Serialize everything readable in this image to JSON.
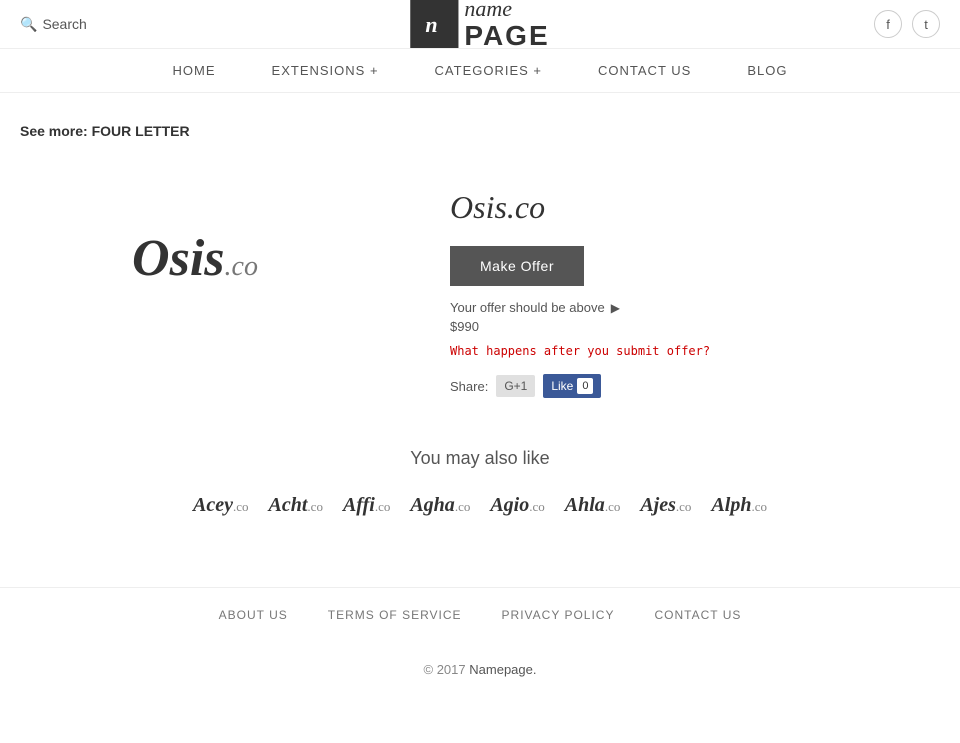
{
  "header": {
    "search_label": "Search",
    "logo_icon": "n",
    "logo_name": "name",
    "logo_page": "PAGE",
    "facebook_label": "f",
    "twitter_label": "t"
  },
  "nav": {
    "items": [
      {
        "id": "home",
        "label": "HOME"
      },
      {
        "id": "extensions",
        "label": "EXTENSIONS +"
      },
      {
        "id": "categories",
        "label": "CATEGORIES +"
      },
      {
        "id": "contact",
        "label": "CONTACT US"
      },
      {
        "id": "blog",
        "label": "BLOG"
      }
    ]
  },
  "content": {
    "see_more_prefix": "See more:",
    "see_more_value": "FOUR LETTER",
    "domain_name": "Osis",
    "domain_tld": ".co",
    "domain_full": "Osis.co",
    "make_offer_label": "Make Offer",
    "offer_hint_text": "Your offer should be above",
    "offer_amount": "$990",
    "submit_link_text": "What happens after you submit offer?",
    "share_label": "Share:",
    "g_plus_label": "G+1",
    "fb_like_label": "Like",
    "fb_count": "0",
    "also_like_title": "You may also like",
    "domains": [
      {
        "name": "Acey",
        "tld": ".co"
      },
      {
        "name": "Acht",
        "tld": ".co"
      },
      {
        "name": "Affi",
        "tld": ".co"
      },
      {
        "name": "Agha",
        "tld": ".co"
      },
      {
        "name": "Agio",
        "tld": ".co"
      },
      {
        "name": "Ahla",
        "tld": ".co"
      },
      {
        "name": "Ajes",
        "tld": ".co"
      },
      {
        "name": "Alph",
        "tld": ".co"
      }
    ]
  },
  "footer": {
    "nav_items": [
      {
        "id": "about",
        "label": "ABOUT US"
      },
      {
        "id": "terms",
        "label": "TERMS OF SERVICE"
      },
      {
        "id": "privacy",
        "label": "PRIVACY POLICY"
      },
      {
        "id": "contact",
        "label": "CONTACT US"
      }
    ],
    "copyright": "© 2017",
    "brand": "Namepage."
  }
}
